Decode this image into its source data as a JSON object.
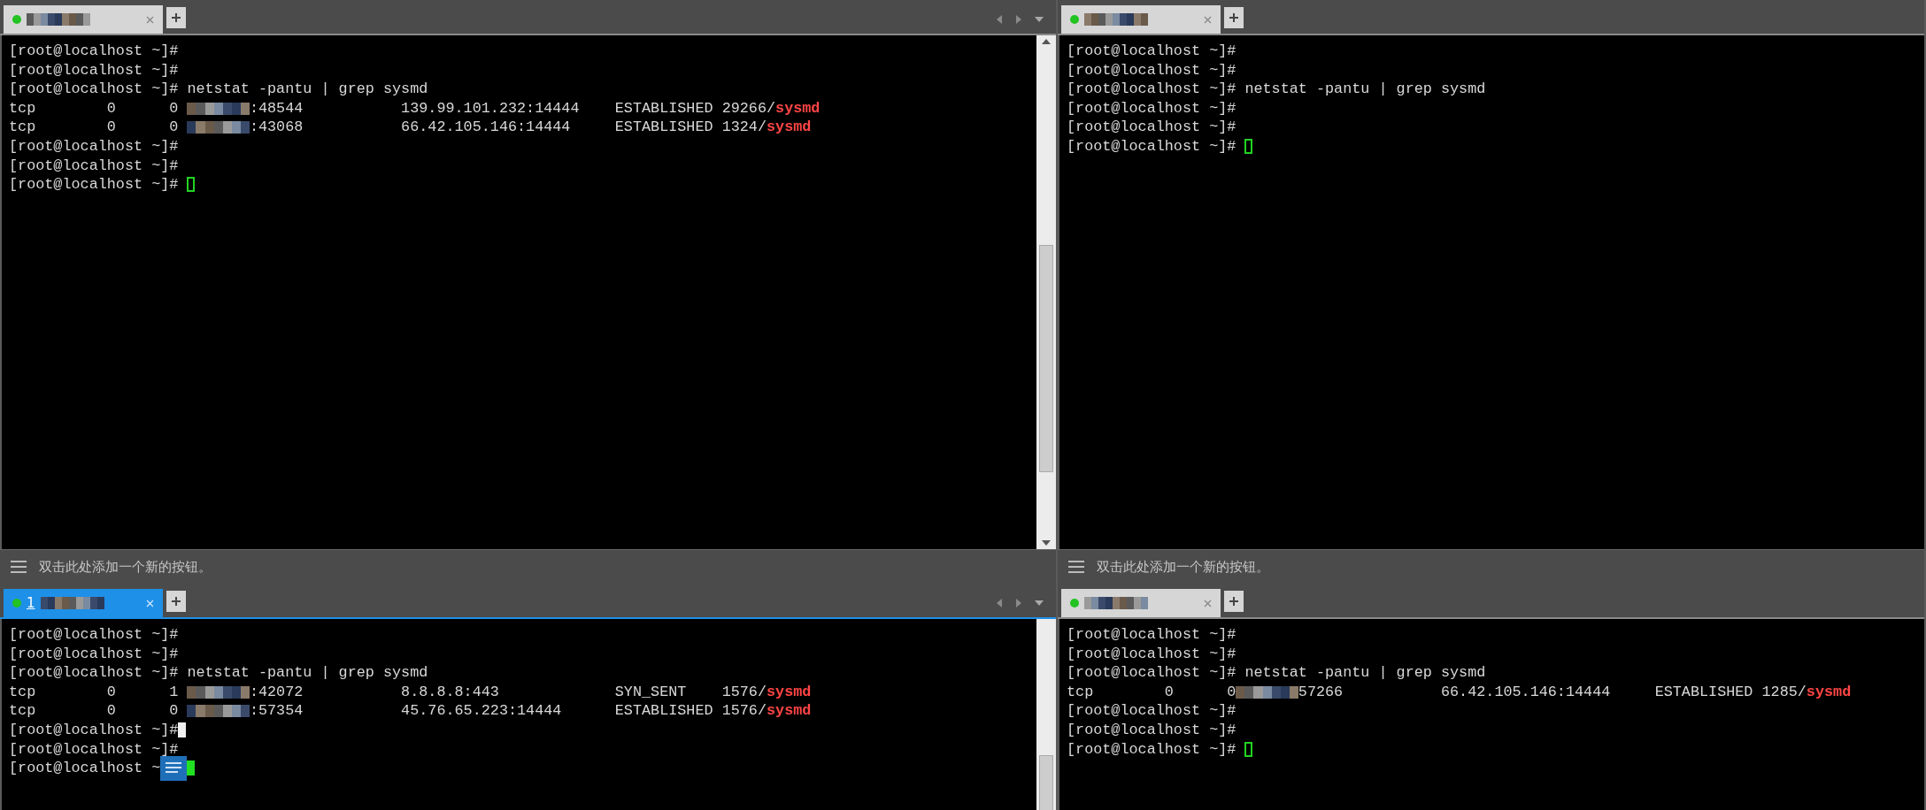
{
  "panes": [
    {
      "tab": {
        "selected": false
      },
      "nav_arrows": true,
      "scrollbar": true,
      "lines": [
        [
          {
            "kind": "text",
            "text": "[root@localhost ~]#"
          }
        ],
        [
          {
            "kind": "text",
            "text": "[root@localhost ~]#"
          }
        ],
        [
          {
            "kind": "text",
            "text": "[root@localhost ~]# netstat -pantu | grep sysmd"
          }
        ],
        [
          {
            "kind": "text",
            "text": "tcp        0      0 "
          },
          {
            "kind": "redacted"
          },
          {
            "kind": "text",
            "text": ":48544           139.99.101.232:14444    ESTABLISHED 29266/"
          },
          {
            "kind": "highlight",
            "text": "sysmd"
          }
        ],
        [
          {
            "kind": "text",
            "text": "tcp        0      0 "
          },
          {
            "kind": "redacted"
          },
          {
            "kind": "text",
            "text": ":43068           66.42.105.146:14444     ESTABLISHED 1324/"
          },
          {
            "kind": "highlight",
            "text": "sysmd"
          }
        ],
        [
          {
            "kind": "text",
            "text": "[root@localhost ~]#"
          }
        ],
        [
          {
            "kind": "text",
            "text": "[root@localhost ~]#"
          }
        ],
        [
          {
            "kind": "text",
            "text": "[root@localhost ~]# "
          },
          {
            "kind": "cursor_hollow"
          }
        ]
      ],
      "button_bar": {
        "hint": "双击此处添加一个新的按钮。"
      }
    },
    {
      "tab": {
        "selected": false
      },
      "nav_arrows": false,
      "scrollbar": false,
      "lines": [
        [
          {
            "kind": "text",
            "text": "[root@localhost ~]#"
          }
        ],
        [
          {
            "kind": "text",
            "text": "[root@localhost ~]#"
          }
        ],
        [
          {
            "kind": "text",
            "text": "[root@localhost ~]# netstat -pantu | grep sysmd"
          }
        ],
        [
          {
            "kind": "text",
            "text": "[root@localhost ~]#"
          }
        ],
        [
          {
            "kind": "text",
            "text": "[root@localhost ~]#"
          }
        ],
        [
          {
            "kind": "text",
            "text": "[root@localhost ~]# "
          },
          {
            "kind": "cursor_hollow"
          }
        ]
      ],
      "button_bar": {
        "hint": "双击此处添加一个新的按钮。"
      }
    },
    {
      "tab": {
        "selected": true,
        "title": "1"
      },
      "nav_arrows": true,
      "scrollbar": true,
      "lines": [
        [
          {
            "kind": "text",
            "text": "[root@localhost ~]#"
          }
        ],
        [
          {
            "kind": "text",
            "text": "[root@localhost ~]#"
          }
        ],
        [
          {
            "kind": "text",
            "text": "[root@localhost ~]# netstat -pantu | grep sysmd"
          }
        ],
        [
          {
            "kind": "text",
            "text": "tcp        0      1 "
          },
          {
            "kind": "redacted"
          },
          {
            "kind": "text",
            "text": ":42072           8.8.8.8:443             SYN_SENT    1576/"
          },
          {
            "kind": "highlight",
            "text": "sysmd"
          }
        ],
        [
          {
            "kind": "text",
            "text": "tcp        0      0 "
          },
          {
            "kind": "redacted"
          },
          {
            "kind": "text",
            "text": ":57354           45.76.65.223:14444      ESTABLISHED 1576/"
          },
          {
            "kind": "highlight",
            "text": "sysmd"
          }
        ],
        [
          {
            "kind": "text",
            "text": "[root@localhost ~]#"
          },
          {
            "kind": "cursor_white"
          }
        ],
        [
          {
            "kind": "text",
            "text": "[root@localhost ~]#"
          }
        ],
        [
          {
            "kind": "text",
            "text": "[root@localhost ~"
          },
          {
            "kind": "overlay_icon"
          },
          {
            "kind": "cursor_green"
          }
        ]
      ]
    },
    {
      "tab": {
        "selected": false
      },
      "nav_arrows": false,
      "scrollbar": false,
      "lines": [
        [
          {
            "kind": "text",
            "text": "[root@localhost ~]#"
          }
        ],
        [
          {
            "kind": "text",
            "text": "[root@localhost ~]#"
          }
        ],
        [
          {
            "kind": "text",
            "text": "[root@localhost ~]# netstat -pantu | grep sysmd"
          }
        ],
        [
          {
            "kind": "text",
            "text": "tcp        0      0"
          },
          {
            "kind": "redacted"
          },
          {
            "kind": "text",
            "text": "57266           66.42.105.146:14444     ESTABLISHED 1285/"
          },
          {
            "kind": "highlight",
            "text": "sysmd"
          }
        ],
        [
          {
            "kind": "text",
            "text": "[root@localhost ~]#"
          }
        ],
        [
          {
            "kind": "text",
            "text": "[root@localhost ~]#"
          }
        ],
        [
          {
            "kind": "text",
            "text": "[root@localhost ~]# "
          },
          {
            "kind": "cursor_hollow"
          }
        ]
      ]
    }
  ]
}
